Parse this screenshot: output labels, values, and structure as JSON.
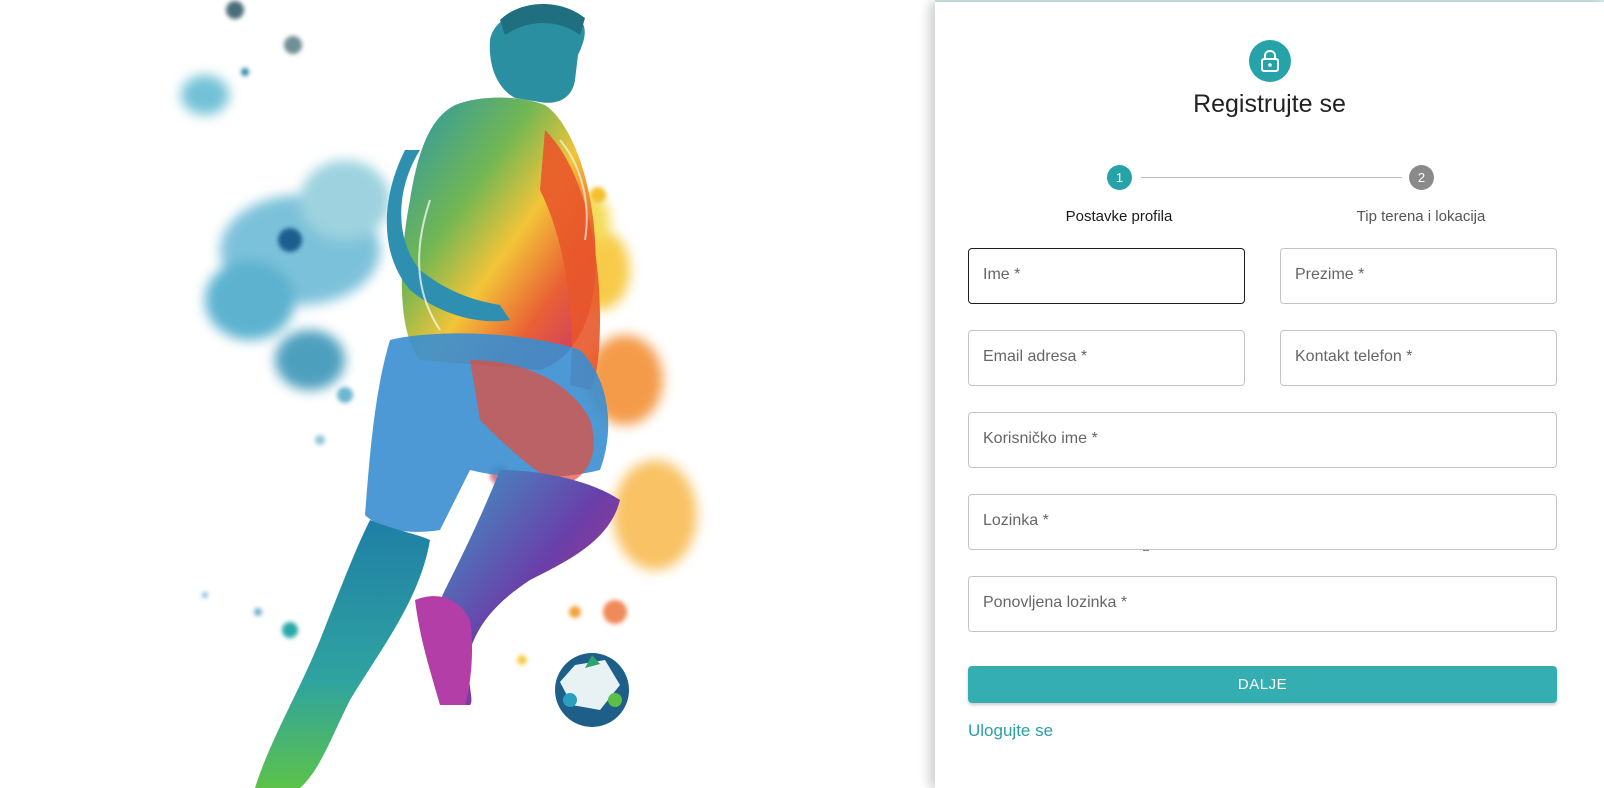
{
  "title": "Registrujte se",
  "stepper": {
    "steps": [
      {
        "number": "1",
        "label": "Postavke profila",
        "active": true
      },
      {
        "number": "2",
        "label": "Tip terena i lokacija",
        "active": false
      }
    ]
  },
  "fields": {
    "ime": {
      "label": "Ime *"
    },
    "prezime": {
      "label": "Prezime *"
    },
    "email": {
      "label": "Email adresa *"
    },
    "telefon": {
      "label": "Kontakt telefon *"
    },
    "korisnicko_ime": {
      "label": "Korisničko ime *"
    },
    "lozinka": {
      "label": "Lozinka *"
    },
    "ponovljena_lozinka": {
      "label": "Ponovljena lozinka *"
    }
  },
  "submit_label": "DALJE",
  "login_link": "Ulogujte se",
  "icons": {
    "header": "lock-icon",
    "artwork": "soccer-player-watercolor"
  },
  "colors": {
    "accent": "#25a3a9",
    "button": "#35aeb2",
    "link": "#2a9fa6",
    "inactive_step": "#8a8a8a"
  }
}
